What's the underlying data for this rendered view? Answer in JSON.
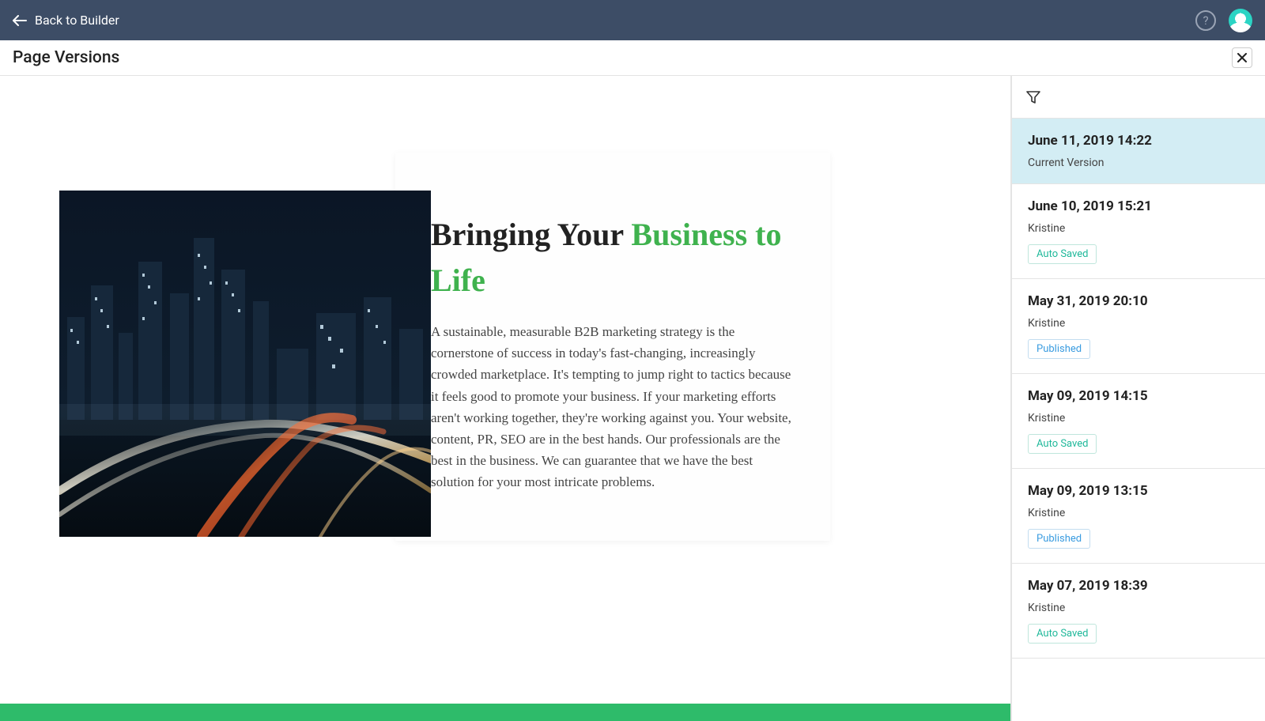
{
  "header": {
    "back_label": "Back to Builder"
  },
  "subheader": {
    "title": "Page Versions"
  },
  "preview": {
    "heading_part1": "Bringing Your ",
    "heading_part2": "Business to Life",
    "body": "A sustainable, measurable B2B marketing strategy is the cornerstone of success in today's fast-changing, increasingly crowded marketplace. It's tempting to jump right to tactics because it feels good to promote your business. If your marketing efforts aren't working together, they're working against you. Your website, content, PR, SEO are in the best hands. Our professionals are the best in the business. We can guarantee that we have the best solution for your most intricate problems."
  },
  "versions": [
    {
      "date": "June 11, 2019 14:22",
      "meta": "Current Version",
      "badge": null,
      "selected": true
    },
    {
      "date": "June 10, 2019 15:21",
      "meta": "Kristine",
      "badge": "Auto Saved",
      "badge_type": "auto",
      "selected": false
    },
    {
      "date": "May 31, 2019 20:10",
      "meta": "Kristine",
      "badge": "Published",
      "badge_type": "pub",
      "selected": false
    },
    {
      "date": "May 09, 2019 14:15",
      "meta": "Kristine",
      "badge": "Auto Saved",
      "badge_type": "auto",
      "selected": false
    },
    {
      "date": "May 09, 2019 13:15",
      "meta": "Kristine",
      "badge": "Published",
      "badge_type": "pub",
      "selected": false
    },
    {
      "date": "May 07, 2019 18:39",
      "meta": "Kristine",
      "badge": "Auto Saved",
      "badge_type": "auto",
      "selected": false
    }
  ]
}
